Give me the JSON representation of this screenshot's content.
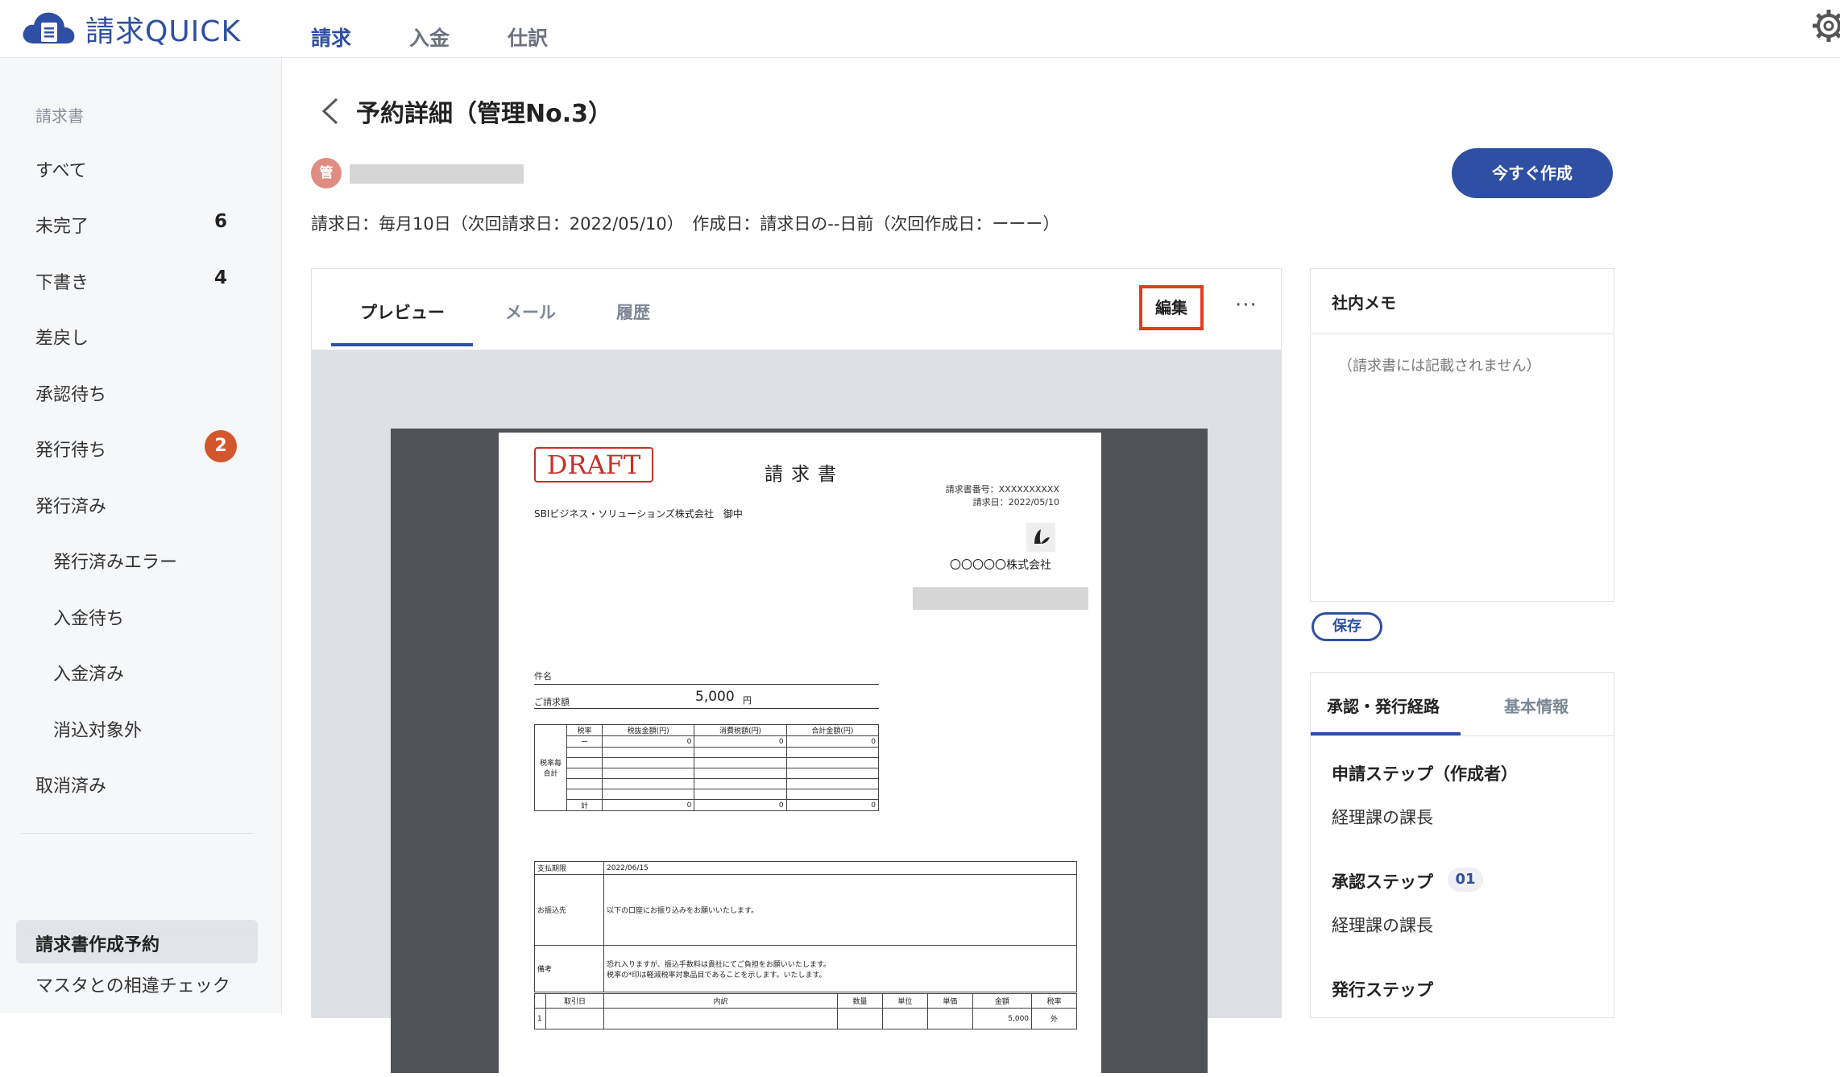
{
  "app": {
    "logo_text": "請求QUICK"
  },
  "nav": {
    "items": [
      "請求",
      "入金",
      "仕訳"
    ]
  },
  "sidebar": {
    "section_heading": "請求書",
    "items": [
      {
        "label": "すべて"
      },
      {
        "label": "未完了",
        "count": "6"
      },
      {
        "label": "下書き",
        "count": "4"
      },
      {
        "label": "差戻し"
      },
      {
        "label": "承認待ち"
      },
      {
        "label": "発行待ち",
        "badge": "2"
      },
      {
        "label": "発行済み"
      },
      {
        "label": "発行済みエラー"
      },
      {
        "label": "入金待ち"
      },
      {
        "label": "入金済み"
      },
      {
        "label": "消込対象外"
      },
      {
        "label": "取消済み"
      }
    ],
    "active_item": "請求書作成予約",
    "bottom_item": "マスタとの相違チェック"
  },
  "page": {
    "title": "予約詳細（管理No.3）",
    "avatar_char": "管",
    "info": "請求日：毎月10日（次回請求日：2022/05/10）　作成日：請求日の--日前（次回作成日：ーーー）",
    "create_now_label": "今すぐ作成"
  },
  "preview": {
    "tabs": [
      "プレビュー",
      "メール",
      "履歴"
    ],
    "edit_label": "編集",
    "more_label": "···"
  },
  "invoice": {
    "draft_label": "DRAFT",
    "title": "請求書",
    "number_line": "請求書番号：XXXXXXXXXX",
    "date_line": "請求日：2022/05/10",
    "customer": "SBIビジネス・ソリューションズ株式会社　御中",
    "company": "〇〇〇〇〇株式会社",
    "subject_label": "件名",
    "amount_label": "ご請求額",
    "amount": "5,000",
    "yen": "円",
    "tax_headers": [
      "税率",
      "税抜金額(円)",
      "消費税額(円)",
      "合計金額(円)"
    ],
    "tax_row_label": "税率毎合計",
    "tax_dash": "ー",
    "tax_total_label": "計",
    "zero": "0",
    "due_label": "支払期限",
    "due_date": "2022/06/15",
    "transfer_label": "お振込先",
    "transfer_text": "以下の口座にお振り込みをお願いいたします。",
    "remarks_label": "備考",
    "remarks_line1": "恐れ入りますが、振込手数料は貴社にてご負担をお願いいたします。",
    "remarks_line2": "税率の*印は軽減税率対象品目であることを示します。いたします。",
    "detail_headers": [
      "取引日",
      "内訳",
      "数量",
      "単位",
      "単価",
      "金額",
      "税率"
    ],
    "detail_row_no": "1",
    "detail_amount": "5,000",
    "detail_tax": "外"
  },
  "memo": {
    "title": "社内メモ",
    "placeholder": "（請求書には記載されません）",
    "save_label": "保存"
  },
  "route": {
    "tabs": [
      "承認・発行経路",
      "基本情報"
    ],
    "apply_step": "申請ステップ（作成者）",
    "apply_person": "経理課の課長",
    "approve_step": "承認ステップ",
    "approve_num": "01",
    "approve_person": "経理課の課長",
    "issue_step": "発行ステップ"
  }
}
